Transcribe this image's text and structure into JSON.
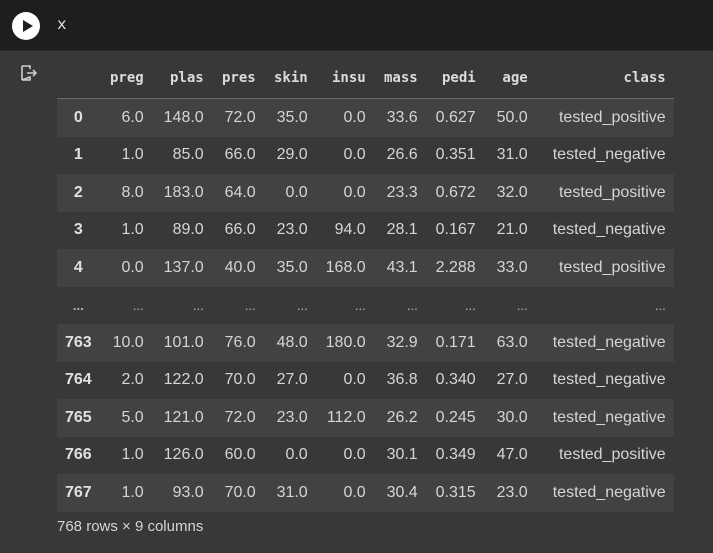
{
  "cell": {
    "code": "x"
  },
  "table": {
    "columns": [
      "preg",
      "plas",
      "pres",
      "skin",
      "insu",
      "mass",
      "pedi",
      "age",
      "class"
    ],
    "rows": [
      {
        "index": "0",
        "cells": [
          "6.0",
          "148.0",
          "72.0",
          "35.0",
          "0.0",
          "33.6",
          "0.627",
          "50.0",
          "tested_positive"
        ]
      },
      {
        "index": "1",
        "cells": [
          "1.0",
          "85.0",
          "66.0",
          "29.0",
          "0.0",
          "26.6",
          "0.351",
          "31.0",
          "tested_negative"
        ]
      },
      {
        "index": "2",
        "cells": [
          "8.0",
          "183.0",
          "64.0",
          "0.0",
          "0.0",
          "23.3",
          "0.672",
          "32.0",
          "tested_positive"
        ]
      },
      {
        "index": "3",
        "cells": [
          "1.0",
          "89.0",
          "66.0",
          "23.0",
          "94.0",
          "28.1",
          "0.167",
          "21.0",
          "tested_negative"
        ]
      },
      {
        "index": "4",
        "cells": [
          "0.0",
          "137.0",
          "40.0",
          "35.0",
          "168.0",
          "43.1",
          "2.288",
          "33.0",
          "tested_positive"
        ]
      },
      {
        "index": "...",
        "cells": [
          "...",
          "...",
          "...",
          "...",
          "...",
          "...",
          "...",
          "...",
          "..."
        ]
      },
      {
        "index": "763",
        "cells": [
          "10.0",
          "101.0",
          "76.0",
          "48.0",
          "180.0",
          "32.9",
          "0.171",
          "63.0",
          "tested_negative"
        ]
      },
      {
        "index": "764",
        "cells": [
          "2.0",
          "122.0",
          "70.0",
          "27.0",
          "0.0",
          "36.8",
          "0.340",
          "27.0",
          "tested_negative"
        ]
      },
      {
        "index": "765",
        "cells": [
          "5.0",
          "121.0",
          "72.0",
          "23.0",
          "112.0",
          "26.2",
          "0.245",
          "30.0",
          "tested_negative"
        ]
      },
      {
        "index": "766",
        "cells": [
          "1.0",
          "126.0",
          "60.0",
          "0.0",
          "0.0",
          "30.1",
          "0.349",
          "47.0",
          "tested_positive"
        ]
      },
      {
        "index": "767",
        "cells": [
          "1.0",
          "93.0",
          "70.0",
          "31.0",
          "0.0",
          "30.4",
          "0.315",
          "23.0",
          "tested_negative"
        ]
      }
    ],
    "summary": "768 rows × 9 columns"
  },
  "icons": {
    "run": "play-circle-icon",
    "output": "output-arrow-icon"
  },
  "colors": {
    "background": "#383838",
    "cell_top": "#1e1e1e",
    "row_stripe": "#424242"
  }
}
